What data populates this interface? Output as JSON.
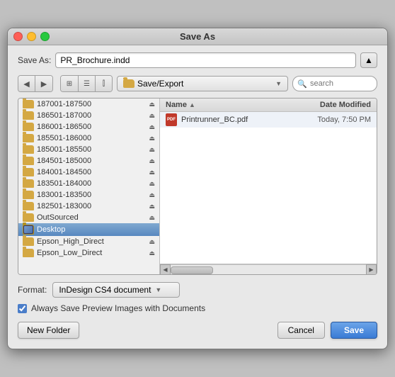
{
  "window": {
    "title": "Save As"
  },
  "save_as": {
    "label": "Save As:",
    "value": "PR_Brochure.indd"
  },
  "toolbar": {
    "location": "Save/Export",
    "search_placeholder": "search"
  },
  "left_pane": {
    "items": [
      {
        "label": "187001-187500",
        "selected": false,
        "has_eject": true
      },
      {
        "label": "186501-187000",
        "selected": false,
        "has_eject": true
      },
      {
        "label": "186001-186500",
        "selected": false,
        "has_eject": true
      },
      {
        "label": "185501-186000",
        "selected": false,
        "has_eject": true
      },
      {
        "label": "185001-185500",
        "selected": false,
        "has_eject": true
      },
      {
        "label": "184501-185000",
        "selected": false,
        "has_eject": true
      },
      {
        "label": "184001-184500",
        "selected": false,
        "has_eject": true
      },
      {
        "label": "183501-184000",
        "selected": false,
        "has_eject": true
      },
      {
        "label": "183001-183500",
        "selected": false,
        "has_eject": true
      },
      {
        "label": "182501-183000",
        "selected": false,
        "has_eject": true
      },
      {
        "label": "OutSourced",
        "selected": false,
        "has_eject": true
      },
      {
        "label": "Desktop",
        "selected": true,
        "has_eject": false,
        "is_desktop": true
      },
      {
        "label": "Epson_High_Direct",
        "selected": false,
        "has_eject": true
      },
      {
        "label": "Epson_Low_Direct",
        "selected": false,
        "has_eject": true
      }
    ]
  },
  "right_pane": {
    "columns": {
      "name": "Name",
      "date": "Date Modified"
    },
    "files": [
      {
        "name": "Printrunner_BC.pdf",
        "date": "Today, 7:50 PM",
        "type": "pdf"
      }
    ]
  },
  "format": {
    "label": "Format:",
    "value": "InDesign CS4 document",
    "arrow": "▼"
  },
  "checkbox": {
    "label": "Always Save Preview Images with Documents",
    "checked": true
  },
  "buttons": {
    "new_folder": "New Folder",
    "cancel": "Cancel",
    "save": "Save"
  }
}
